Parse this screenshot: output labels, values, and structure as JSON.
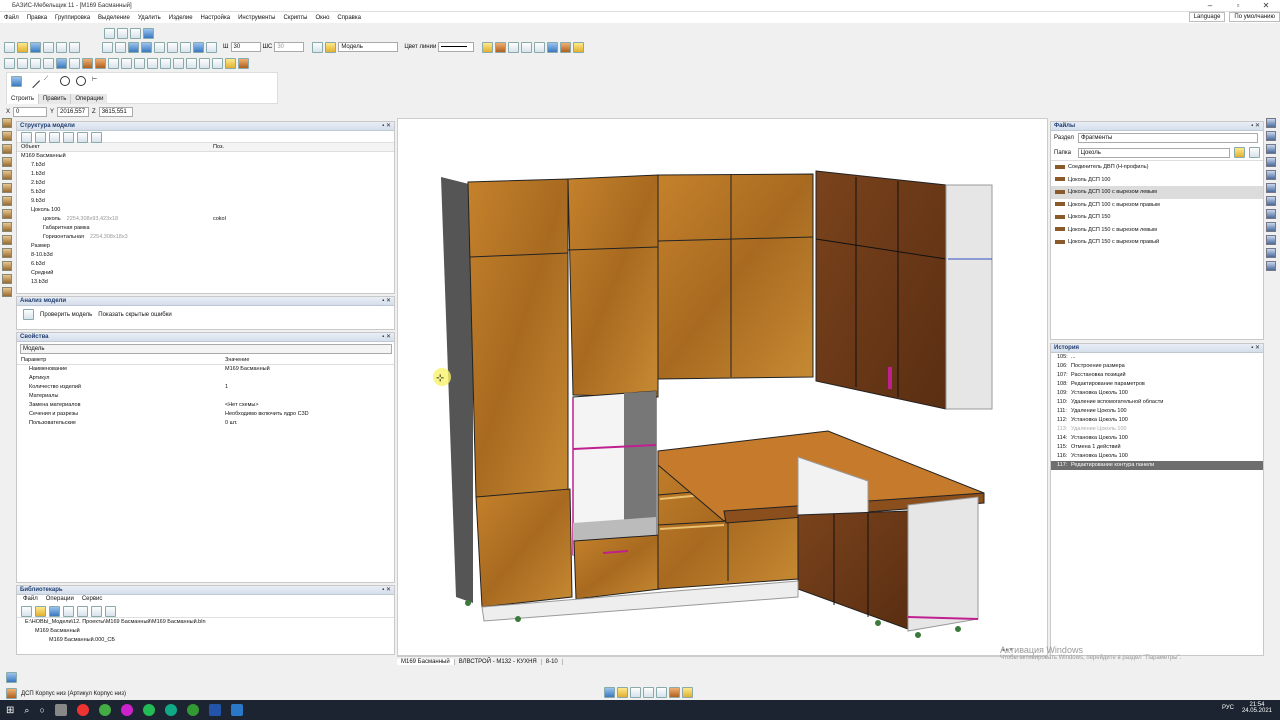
{
  "window": {
    "title": "БАЗИС-Мебельщик 11 - [М169 Басманный]"
  },
  "menu": [
    "Файл",
    "Правка",
    "Группировка",
    "Выделение",
    "Удалить",
    "Изделие",
    "Настройка",
    "Инструменты",
    "Скрипты",
    "Окно",
    "Справка"
  ],
  "menu_right": {
    "language": "Language",
    "default": "По умолчанию"
  },
  "toolbar": {
    "w_label": "Ш",
    "w_value": "30",
    "hc_label": "ШС",
    "hc_value": "30",
    "layer": "Модель",
    "line_color_label": "Цвет линии"
  },
  "build_tabs": [
    "Строить",
    "Править",
    "Операции"
  ],
  "coords": {
    "x_label": "X",
    "x": "0",
    "y_label": "Y",
    "y": "2016,557",
    "z_label": "Z",
    "z": "3615,551"
  },
  "structure": {
    "title": "Структура модели",
    "col_object": "Объект",
    "col_pos": "Поз.",
    "items": [
      {
        "text": "М169 Басманный",
        "extra": ""
      },
      {
        "text": "7.b3d",
        "extra": ""
      },
      {
        "text": "1.b3d",
        "extra": ""
      },
      {
        "text": "2.b3d",
        "extra": ""
      },
      {
        "text": "5.b3d",
        "extra": ""
      },
      {
        "text": "9.b3d",
        "extra": ""
      },
      {
        "text": "Цоколь 100",
        "extra": ""
      },
      {
        "text": "цоколь",
        "gray": "2254,308x93,423x18",
        "extra": "cokol"
      },
      {
        "text": "Габаритная рамка",
        "extra": ""
      },
      {
        "text": "Горизонтальная",
        "gray": "2254,308x18x3",
        "extra": ""
      },
      {
        "text": "Размер",
        "extra": ""
      },
      {
        "text": "8-10.b3d",
        "extra": ""
      },
      {
        "text": "6.b3d",
        "extra": ""
      },
      {
        "text": "Средний",
        "extra": ""
      },
      {
        "text": "13.b3d",
        "extra": ""
      }
    ]
  },
  "analysis": {
    "title": "Анализ модели",
    "check": "Проверить модель",
    "show_hidden": "Показать скрытые ошибки"
  },
  "properties": {
    "title": "Свойства",
    "select": "Модель",
    "col_param": "Параметр",
    "col_value": "Значение",
    "rows": [
      {
        "param": "Наименование",
        "value": "М169 Басманный"
      },
      {
        "param": "Артикул",
        "value": ""
      },
      {
        "param": "Количество изделий",
        "value": "1"
      },
      {
        "param": "Материалы",
        "value": ""
      },
      {
        "param": "Замена материалов",
        "value": "<Нет схемы>"
      },
      {
        "param": "Сечения и разрезы",
        "value": "Необходимо включить ядро C3D"
      },
      {
        "param": "Пользовательские",
        "value": "0 шт."
      }
    ]
  },
  "library": {
    "title": "Библиотекарь",
    "menu": [
      "Файл",
      "Операции",
      "Сервис"
    ],
    "items": [
      "E:\\НОВЫ_Модели\\12. Проекты\\М169 Басманный\\М169 Басманный.bln",
      "М169 Басманный",
      "М169 Басманный.000_СБ"
    ]
  },
  "files": {
    "title": "Файлы",
    "section_label": "Раздел",
    "section": "Фрагменты",
    "folder_label": "Папка",
    "folder": "Цоколь",
    "items": [
      "Соединитель ДВП (Н-профиль)",
      "Цоколь ДСП 100",
      "Цоколь ДСП 100 с вырезом левым",
      "Цоколь ДСП 100 с вырезом правым",
      "Цоколь ДСП 150",
      "Цоколь ДСП 150 с вырезом левым",
      "Цоколь ДСП 150 с вырезом правый"
    ]
  },
  "history": {
    "title": "История",
    "items": [
      {
        "n": "105:",
        "t": "..."
      },
      {
        "n": "106:",
        "t": "Построение размера"
      },
      {
        "n": "107:",
        "t": "Расстановка позиций"
      },
      {
        "n": "108:",
        "t": "Редактирование параметров"
      },
      {
        "n": "109:",
        "t": "Установка Цоколь 100"
      },
      {
        "n": "110:",
        "t": "Удаление вспомогательной области"
      },
      {
        "n": "111:",
        "t": "Удаление Цоколь 100"
      },
      {
        "n": "112:",
        "t": "Установка Цоколь 100"
      },
      {
        "n": "113:",
        "t": "Удаление Цоколь 100"
      },
      {
        "n": "114:",
        "t": "Установка Цоколь 100"
      },
      {
        "n": "115:",
        "t": "Отмена 1 действий"
      },
      {
        "n": "116:",
        "t": "Установка Цоколь 100"
      },
      {
        "n": "117:",
        "t": "Редактирование контура панели"
      }
    ]
  },
  "doc_tabs": [
    "М169 Басманный",
    "ВЛВСТРОЙ - М132 - КУХНЯ",
    "8-10"
  ],
  "watermark": {
    "line1": "Активация Windows",
    "line2": "Чтобы активировать Windows, перейдите в раздел \"Параметры\"."
  },
  "status": {
    "text": "ДСП Корпус низ (Артикул Корпус низ)"
  },
  "tray": {
    "lang": "РУС",
    "time": "21:54",
    "date": "24.05.2021"
  },
  "colors": {
    "wood": "#b8741f",
    "wood_dark": "#6b3a1a",
    "accent": "#1f3d70",
    "taskbar": "#1b2430"
  }
}
